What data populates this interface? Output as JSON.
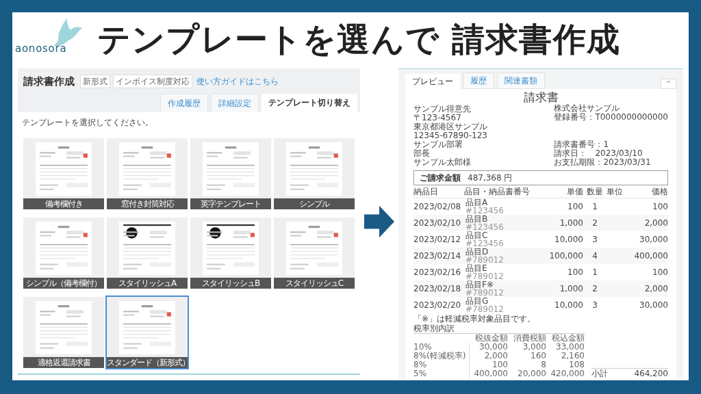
{
  "header": {
    "logo": "aonosora",
    "title": "テンプレートを選んで 請求書作成"
  },
  "editor": {
    "title": "請求書作成",
    "badges": [
      "新形式",
      "インボイス制度対応"
    ],
    "guide_link": "使い方ガイドはこちら",
    "tabs": [
      {
        "label": "作成履歴",
        "selected": false
      },
      {
        "label": "詳細設定",
        "selected": false
      },
      {
        "label": "テンプレート切り替え",
        "selected": true
      }
    ],
    "instruction": "テンプレートを選択してください。",
    "templates": [
      {
        "label": "備考欄付き",
        "selected": false
      },
      {
        "label": "窓付き封筒対応",
        "selected": false
      },
      {
        "label": "英字テンプレート",
        "selected": false
      },
      {
        "label": "シンプル",
        "selected": false
      },
      {
        "label": "シンプル（備考欄付）",
        "selected": false
      },
      {
        "label": "スタイリッシュA",
        "selected": false
      },
      {
        "label": "スタイリッシュB",
        "selected": false
      },
      {
        "label": "スタイリッシュC",
        "selected": false
      },
      {
        "label": "適格返還請求書",
        "selected": false
      },
      {
        "label": "スタンダード（新形式）",
        "selected": true
      }
    ]
  },
  "preview": {
    "tabs": [
      {
        "label": "プレビュー",
        "selected": true
      },
      {
        "label": "履歴",
        "selected": false
      },
      {
        "label": "関連書類",
        "selected": false
      }
    ],
    "collapse": "^",
    "document": {
      "title": "請求書",
      "client_name": "サンプル得意先",
      "client_lines": [
        "〒123-4567",
        "東京都港区サンプル",
        "12345-67890-123",
        "サンプル部署",
        "部長",
        "サンプル太郎様"
      ],
      "issuer_lines": [
        "株式会社サンプル",
        "登録番号：T0000000000000"
      ],
      "meta_lines": [
        "請求書番号：1",
        "請求日：　2023/03/10",
        "お支払期限：2023/03/31"
      ],
      "amount_label": "ご請求金額",
      "amount": "487,368 円",
      "columns": [
        "納品日",
        "品目・納品書番号",
        "単価",
        "数量",
        "単位",
        "価格"
      ],
      "rows": [
        {
          "date": "2023/02/08",
          "item": "品目A",
          "number": "#123456",
          "unit_price": "100",
          "quantity": "1",
          "price": "100"
        },
        {
          "date": "2023/02/10",
          "item": "品目B",
          "number": "#123456",
          "unit_price": "1,000",
          "quantity": "2",
          "price": "2,000"
        },
        {
          "date": "2023/02/12",
          "item": "品目C",
          "number": "#123456",
          "unit_price": "10,000",
          "quantity": "3",
          "price": "30,000"
        },
        {
          "date": "2023/02/14",
          "item": "品目D",
          "number": "#789012",
          "unit_price": "100,000",
          "quantity": "4",
          "price": "400,000"
        },
        {
          "date": "2023/02/16",
          "item": "品目E",
          "number": "#789012",
          "unit_price": "100",
          "quantity": "1",
          "price": "100"
        },
        {
          "date": "2023/02/18",
          "item": "品目F※",
          "number": "#789012",
          "unit_price": "1,000",
          "quantity": "2",
          "price": "2,000"
        },
        {
          "date": "2023/02/20",
          "item": "品目G",
          "number": "#789012",
          "unit_price": "10,000",
          "quantity": "3",
          "price": "30,000"
        }
      ],
      "note": "「※」は軽減税率対象品目です。",
      "tax_title": "税率別内訳",
      "tax_columns": [
        "税抜金額",
        "消費税額",
        "税込金額"
      ],
      "tax_rows": [
        [
          "10%",
          "30,000",
          "3,000",
          "33,000"
        ],
        [
          "8%(軽減税率)",
          "2,000",
          "160",
          "2,160"
        ],
        [
          "8%",
          "100",
          "8",
          "108"
        ],
        [
          "5%",
          "400,000",
          "20,000",
          "420,000"
        ]
      ],
      "subtotal_label": "小計",
      "subtotal": "464,200"
    }
  }
}
